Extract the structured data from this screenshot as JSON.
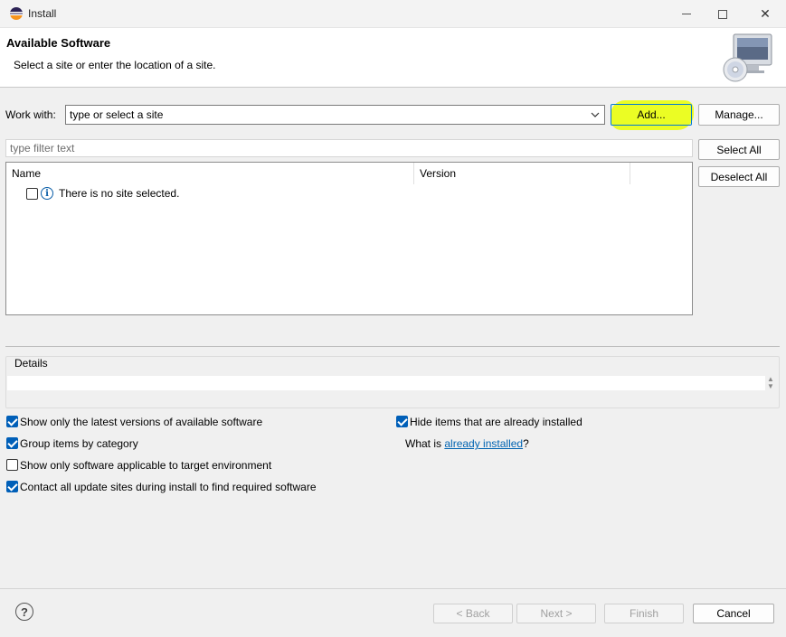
{
  "window": {
    "title": "Install",
    "minimize_icon": "minimize-icon",
    "maximize_icon": "maximize-icon",
    "close_glyph": "✕"
  },
  "header": {
    "title": "Available Software",
    "subtitle": "Select a site or enter the location of a site."
  },
  "work_with": {
    "label": "Work with:",
    "value": "type or select a site",
    "add_label": "Add...",
    "manage_label": "Manage..."
  },
  "filter": {
    "placeholder": "type filter text"
  },
  "selection": {
    "select_all_label": "Select All",
    "deselect_all_label": "Deselect All"
  },
  "table": {
    "columns": [
      "Name",
      "Version"
    ],
    "rows": [
      {
        "checked": false,
        "icon": "info-icon",
        "name": "There is no site selected."
      }
    ]
  },
  "details": {
    "label": "Details"
  },
  "options": {
    "latest_versions": {
      "label": "Show only the latest versions of available software",
      "checked": true
    },
    "group_by_category": {
      "label": "Group items by category",
      "checked": true
    },
    "target_env": {
      "label": "Show only software applicable to target environment",
      "checked": false
    },
    "contact_sites": {
      "label": "Contact all update sites during install to find required software",
      "checked": true
    },
    "hide_installed": {
      "label": "Hide items that are already installed",
      "checked": true
    },
    "what_is_prefix": "What is",
    "what_is_link": "already installed",
    "what_is_suffix": "?"
  },
  "footer": {
    "help_glyph": "?",
    "back_label": "< Back",
    "next_label": "Next >",
    "finish_label": "Finish",
    "cancel_label": "Cancel"
  },
  "colors": {
    "accent": "#005fb8",
    "highlight": "#eaff00",
    "link": "#0063b1"
  }
}
